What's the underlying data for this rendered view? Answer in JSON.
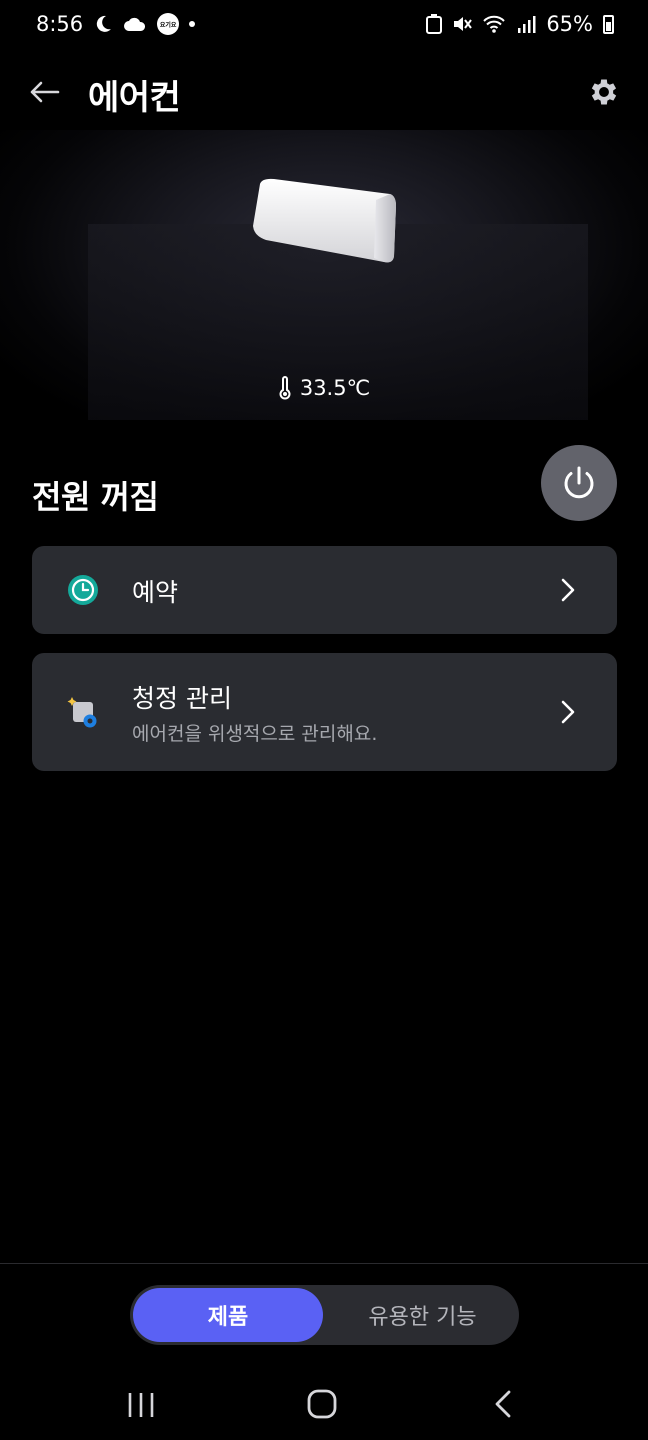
{
  "status_bar": {
    "time": "8:56",
    "kakao_badge": "요기요",
    "battery_percent": "65%"
  },
  "header": {
    "title": "에어컨"
  },
  "hero": {
    "temperature": "33.5℃"
  },
  "power": {
    "state_label": "전원 꺼짐"
  },
  "cards": {
    "schedule": {
      "title": "예약",
      "icon": "clock-icon"
    },
    "cleaning": {
      "title": "청정 관리",
      "subtitle": "에어컨을 위생적으로 관리해요.",
      "icon": "cleaning-settings-icon"
    }
  },
  "bottom_tabs": {
    "product": "제품",
    "useful_features": "유용한 기능"
  },
  "colors": {
    "accent": "#5a61f4",
    "card_bg": "#2a2c31",
    "power_button": "#62636b",
    "clock_teal": "#14a99a"
  }
}
